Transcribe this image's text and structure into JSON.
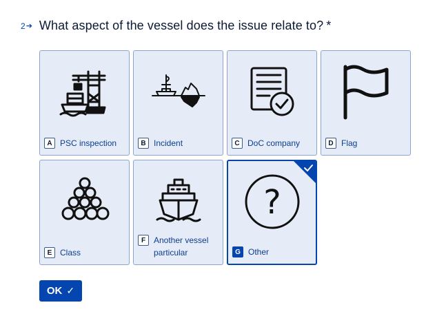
{
  "question": {
    "number": "2",
    "text": "What aspect of the vessel does the issue relate to?",
    "required_mark": "*"
  },
  "options": [
    {
      "key": "A",
      "label": "PSC inspection",
      "icon": "port-crane-ship-icon",
      "selected": false
    },
    {
      "key": "B",
      "label": "Incident",
      "icon": "ship-iceberg-icon",
      "selected": false
    },
    {
      "key": "C",
      "label": "DoC company",
      "icon": "certificate-check-icon",
      "selected": false
    },
    {
      "key": "D",
      "label": "Flag",
      "icon": "flag-icon",
      "selected": false
    },
    {
      "key": "E",
      "label": "Class",
      "icon": "class-pyramid-icon",
      "selected": false
    },
    {
      "key": "F",
      "label": "Another vessel particular",
      "icon": "ship-front-icon",
      "selected": false
    },
    {
      "key": "G",
      "label": "Other",
      "icon": "question-circle-icon",
      "selected": true
    }
  ],
  "ok_button": {
    "label": "OK"
  },
  "colors": {
    "accent": "#0445af",
    "card_bg": "#e6ecf7",
    "card_border": "#8aa3cf"
  }
}
